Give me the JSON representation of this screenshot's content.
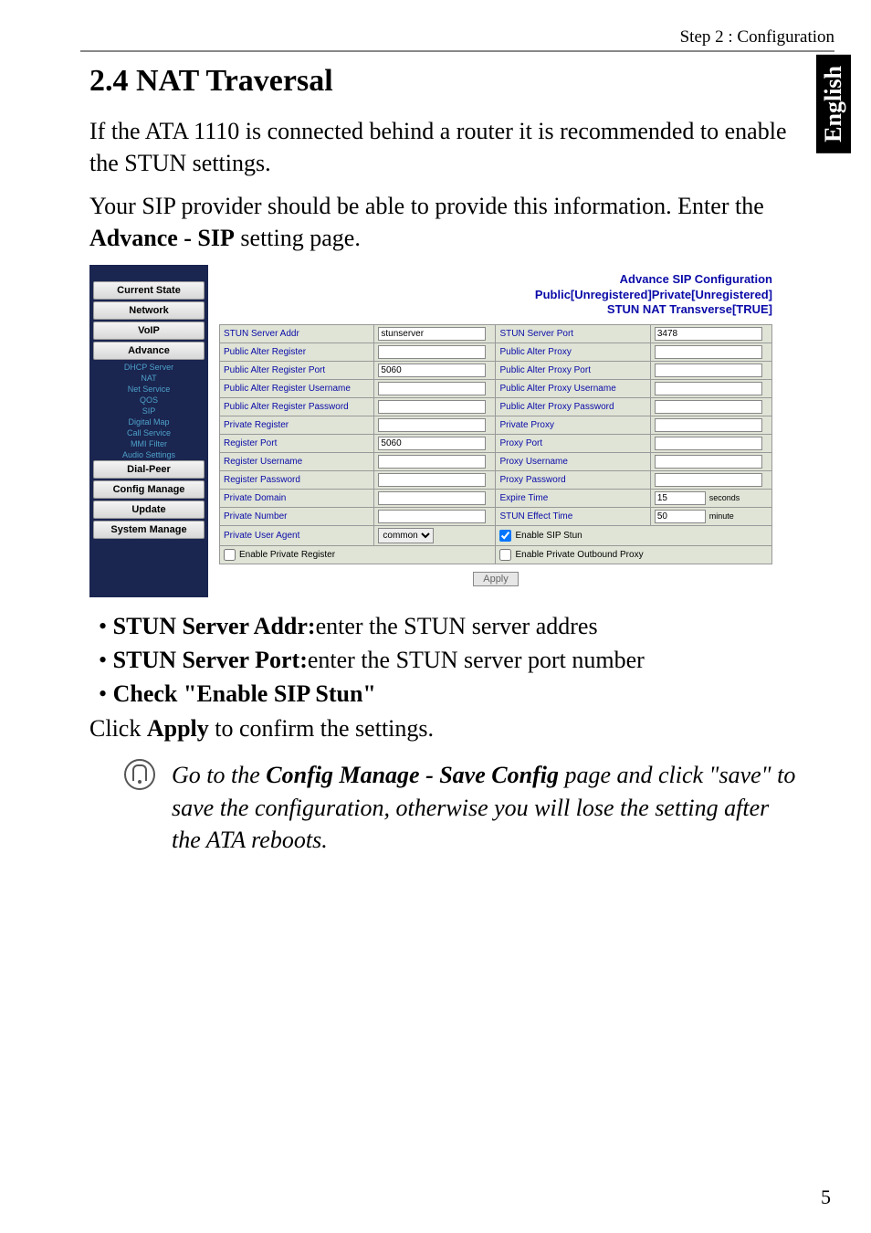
{
  "header": {
    "step": "Step 2 : Configuration"
  },
  "sideTab": "English",
  "section": {
    "title": "2.4  NAT Traversal"
  },
  "intro": {
    "p1": "If the ATA 1110 is connected behind a router it is recommended to enable the STUN settings.",
    "p2": "Your SIP provider should be able to provide this information. Enter the  ",
    "p2_bold": "Advance - SIP",
    "p2_after": " setting page."
  },
  "shot": {
    "sidebar": {
      "items": [
        "Current State",
        "Network",
        "VoIP",
        "Advance"
      ],
      "subs": [
        "DHCP Server",
        "NAT",
        "Net Service",
        "QOS",
        "SIP",
        "Digital Map",
        "Call Service",
        "MMI Filter",
        "Audio Settings"
      ],
      "items2": [
        "Dial-Peer",
        "Config Manage",
        "Update",
        "System Manage"
      ]
    },
    "title": {
      "l1": "Advance SIP Configuration",
      "l2": "Public[Unregistered]Private[Unregistered]",
      "l3": "STUN NAT Transverse[TRUE]"
    },
    "rows": [
      [
        "STUN Server Addr",
        "stunserver",
        "STUN Server Port",
        "3478"
      ],
      [
        "Public Alter Register",
        "",
        "Public Alter Proxy",
        ""
      ],
      [
        "Public Alter Register Port",
        "5060",
        "Public Alter Proxy Port",
        ""
      ],
      [
        "Public Alter Register Username",
        "",
        "Public Alter Proxy Username",
        ""
      ],
      [
        "Public Alter Register Password",
        "",
        "Public Alter Proxy Password",
        ""
      ],
      [
        "Private Register",
        "",
        "Private Proxy",
        ""
      ],
      [
        "Register Port",
        "5060",
        "Proxy Port",
        ""
      ],
      [
        "Register Username",
        "",
        "Proxy Username",
        ""
      ],
      [
        "Register Password",
        "",
        "Proxy Password",
        ""
      ],
      [
        "Private Domain",
        "",
        "Expire Time",
        "15"
      ],
      [
        "Private Number",
        "",
        "STUN Effect Time",
        "50"
      ],
      [
        "Private User Agent",
        "common",
        "Enable SIP Stun",
        "checked"
      ]
    ],
    "units": {
      "expire": "seconds",
      "stun": "minute"
    },
    "bottom": {
      "left": "Enable Private Register",
      "right": "Enable Private Outbound Proxy"
    },
    "apply": "Apply"
  },
  "bullets": {
    "b1_bold": "STUN Server Addr:",
    "b1_rest": "enter the STUN server addres",
    "b2_bold": "STUN Server Port:",
    "b2_rest": "enter the STUN server port number",
    "b3_bold": "Check \"Enable SIP Stun\""
  },
  "afterBullets": {
    "pre": "Click ",
    "bold": "Apply",
    "post": " to confirm the settings."
  },
  "note": {
    "t1": "Go to the ",
    "bold": "Config Manage - Save Config",
    "t2": " page and click \"save\" to save the configuration, otherwise you will lose the setting after the ATA reboots."
  },
  "pageNum": "5"
}
